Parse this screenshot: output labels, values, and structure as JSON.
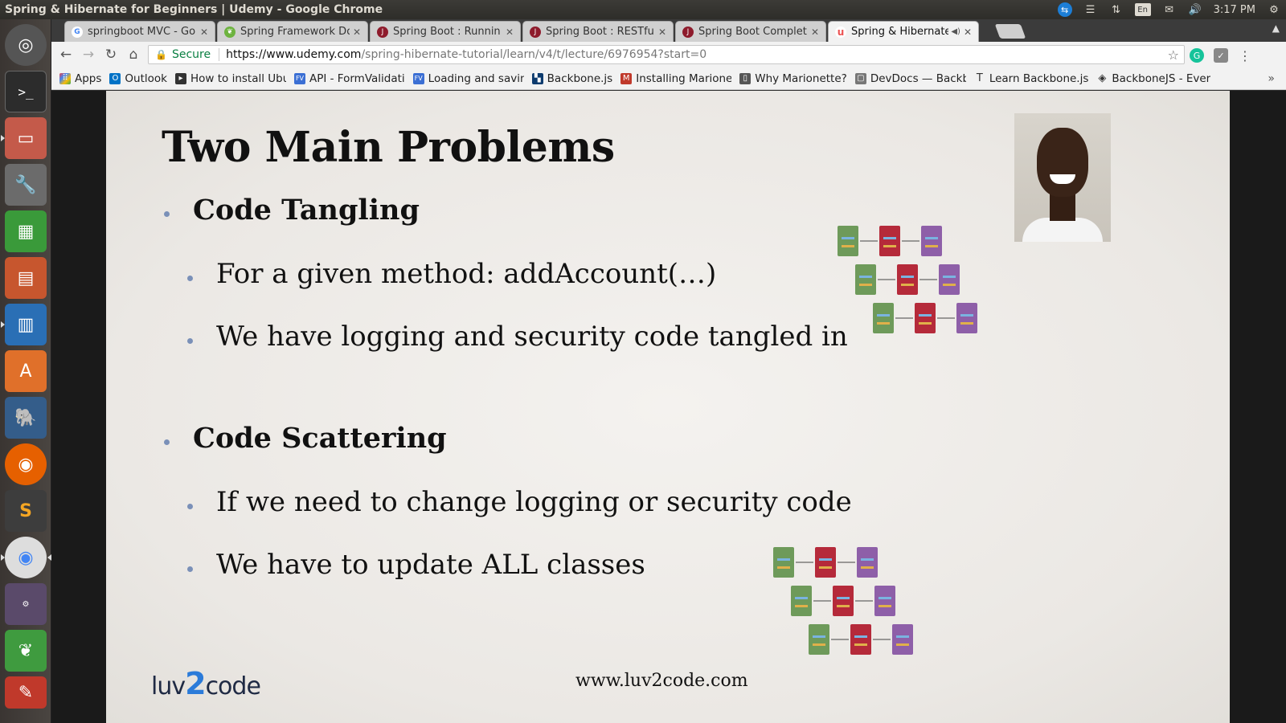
{
  "os": {
    "window_title": "Spring & Hibernate for Beginners | Udemy - Google Chrome",
    "clock": "3:17 PM",
    "lang": "En"
  },
  "tabs": [
    {
      "label": "springboot MVC - Go",
      "favicon": "google-icon",
      "color": "#4285f4"
    },
    {
      "label": "Spring Framework Do",
      "favicon": "spring-leaf-icon",
      "color": "#6db33f"
    },
    {
      "label": "Spring Boot : Runnin",
      "favicon": "javabrains-icon",
      "color": "#8e1b2c"
    },
    {
      "label": "Spring Boot : RESTful",
      "favicon": "javabrains-icon",
      "color": "#8e1b2c"
    },
    {
      "label": "Spring Boot Complet",
      "favicon": "javabrains-icon",
      "color": "#8e1b2c"
    },
    {
      "label": "Spring & Hibernate",
      "favicon": "udemy-icon",
      "color": "#ec5252",
      "active": true
    }
  ],
  "toolbar": {
    "secure_label": "Secure",
    "url_host": "https://www.udemy.com",
    "url_path": "/spring-hibernate-tutorial/learn/v4/t/lecture/6976954?start=0"
  },
  "bookmarks": [
    {
      "label": "Apps",
      "icon": "apps-grid-icon",
      "color": "#e44"
    },
    {
      "label": "Outlook",
      "icon": "outlook-icon",
      "color": "#0072c6"
    },
    {
      "label": "How to install Ubu",
      "icon": "terminal-icon",
      "color": "#333"
    },
    {
      "label": "API - FormValidati",
      "icon": "fv-icon",
      "color": "#3b6fd4"
    },
    {
      "label": "Loading and savin",
      "icon": "fv-icon",
      "color": "#3b6fd4"
    },
    {
      "label": "Backbone.js",
      "icon": "backbone-icon",
      "color": "#0d3b6e"
    },
    {
      "label": "Installing Marione",
      "icon": "marionette-icon",
      "color": "#c0392b"
    },
    {
      "label": "Why Marionette?",
      "icon": "book-icon",
      "color": "#555"
    },
    {
      "label": "DevDocs — Backb",
      "icon": "devdocs-icon",
      "color": "#777"
    },
    {
      "label": "Learn Backbone.js",
      "icon": "text-icon",
      "color": "#555"
    },
    {
      "label": "BackboneJS - Ever",
      "icon": "diamond-icon",
      "color": "#555"
    }
  ],
  "slide": {
    "title": "Two Main Problems",
    "sections": [
      {
        "heading": "Code Tangling",
        "items": [
          "For a given method: addAccount(…)",
          "We have logging and security code tangled in"
        ]
      },
      {
        "heading": "Code Scattering",
        "items": [
          "If we need to change logging or security code",
          "We have to update ALL classes"
        ]
      }
    ],
    "footer_url": "www.luv2code.com",
    "logo": {
      "left": "luv",
      "mid": "2",
      "right": "code"
    },
    "colors": {
      "controller": "#6e9a5a",
      "service": "#b52a3a",
      "dao": "#8e5fa8",
      "bullet": "#7a90b8"
    }
  }
}
